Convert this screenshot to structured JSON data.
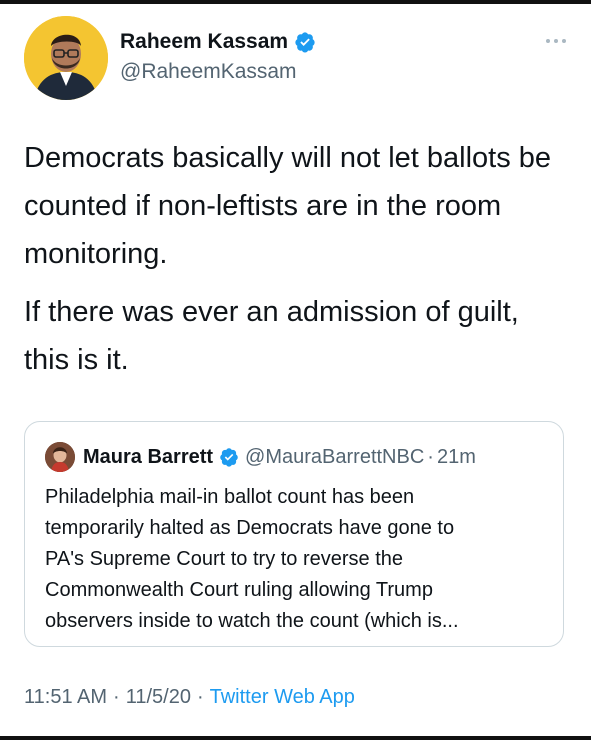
{
  "author": {
    "display_name": "Raheem Kassam",
    "handle": "@RaheemKassam",
    "avatar_bg": "#f4c531",
    "verified": true
  },
  "tweet": {
    "paragraphs": [
      "Democrats basically will not let ballots be counted if non-leftists are in the room monitoring.",
      "If there was ever an admission of guilt, this is it."
    ]
  },
  "quoted_tweet": {
    "display_name": "Maura Barrett",
    "handle": "@MauraBarrettNBC",
    "separator": "·",
    "time": "21m",
    "verified": true,
    "text_lines": [
      "Philadelphia mail-in ballot count has been",
      "temporarily halted as Democrats have gone to",
      "PA's Supreme Court to try to reverse the",
      "Commonwealth Court ruling allowing Trump",
      "observers inside to watch the count (which is..."
    ]
  },
  "meta": {
    "time": "11:51 AM",
    "date": "11/5/20",
    "separator": "·",
    "source": "Twitter Web App"
  },
  "colors": {
    "text_primary": "#0f1419",
    "text_secondary": "#536471",
    "accent": "#1d9bf0",
    "border": "#cfd9de"
  },
  "icons": {
    "verified": "verified-badge-icon",
    "more": "more-dots-icon"
  }
}
